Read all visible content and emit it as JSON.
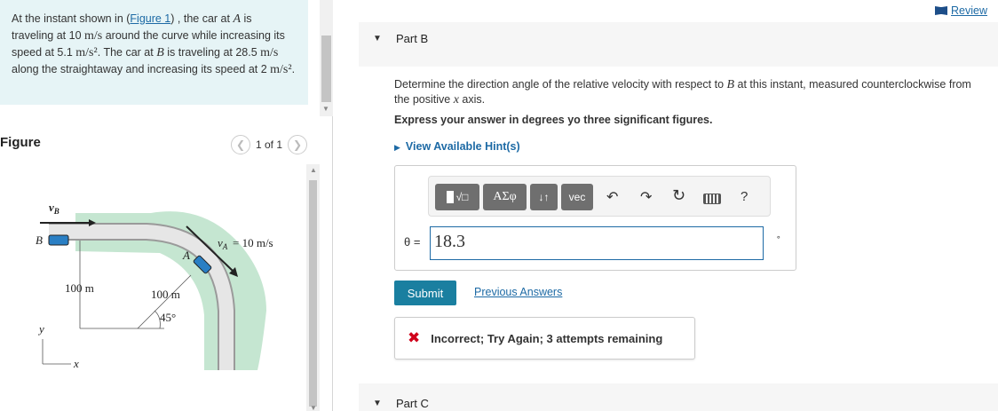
{
  "problem": {
    "p1": "At the instant shown in (",
    "fig_link": "Figure 1",
    "p2": ") , the car at ",
    "carA": "A",
    "p3": " is traveling at 10 ",
    "unit_speed1": "m/s",
    "p4": " around the curve while increasing its speed at 5.1 ",
    "unit_acc1": "m/s²",
    "p5": ". The car at ",
    "carB": "B",
    "p6": " is traveling at 28.5 ",
    "unit_speed2": "m/s",
    "p7": " along the straightaway and increasing its speed at 2 ",
    "unit_acc2": "m/s²",
    "p8": "."
  },
  "figure": {
    "title": "Figure",
    "pager": "1 of 1",
    "labels": {
      "vB": "v",
      "vB_sub": "B",
      "B": "B",
      "A": "A",
      "vA": "v",
      "vA_sub": "A",
      "vA_value": "= 10 m/s",
      "d1": "100 m",
      "d2": "100 m",
      "angle": "45°",
      "y": "y",
      "x": "x"
    }
  },
  "review": "Review",
  "partB": {
    "label": "Part B",
    "question_pre": "Determine the direction angle of the relative velocity with respect to ",
    "question_var": "B",
    "question_mid": " at this instant, measured counterclockwise from the positive ",
    "question_x": "x",
    "question_post": " axis.",
    "express": "Express your answer in degrees yo three significant figures.",
    "hint": "View Available Hint(s)",
    "toolbar": {
      "templates": "√□",
      "symbols": "ΑΣφ",
      "arrows": "↓↑",
      "vec": "vec",
      "undo": "↶",
      "redo": "↷",
      "reset": "↻",
      "help": "?"
    },
    "answer_label": "θ =",
    "answer_value": "18.3",
    "unit": "∘",
    "submit": "Submit",
    "previous": "Previous Answers",
    "feedback": "Incorrect; Try Again; 3 attempts remaining"
  },
  "partC": {
    "label": "Part C"
  }
}
